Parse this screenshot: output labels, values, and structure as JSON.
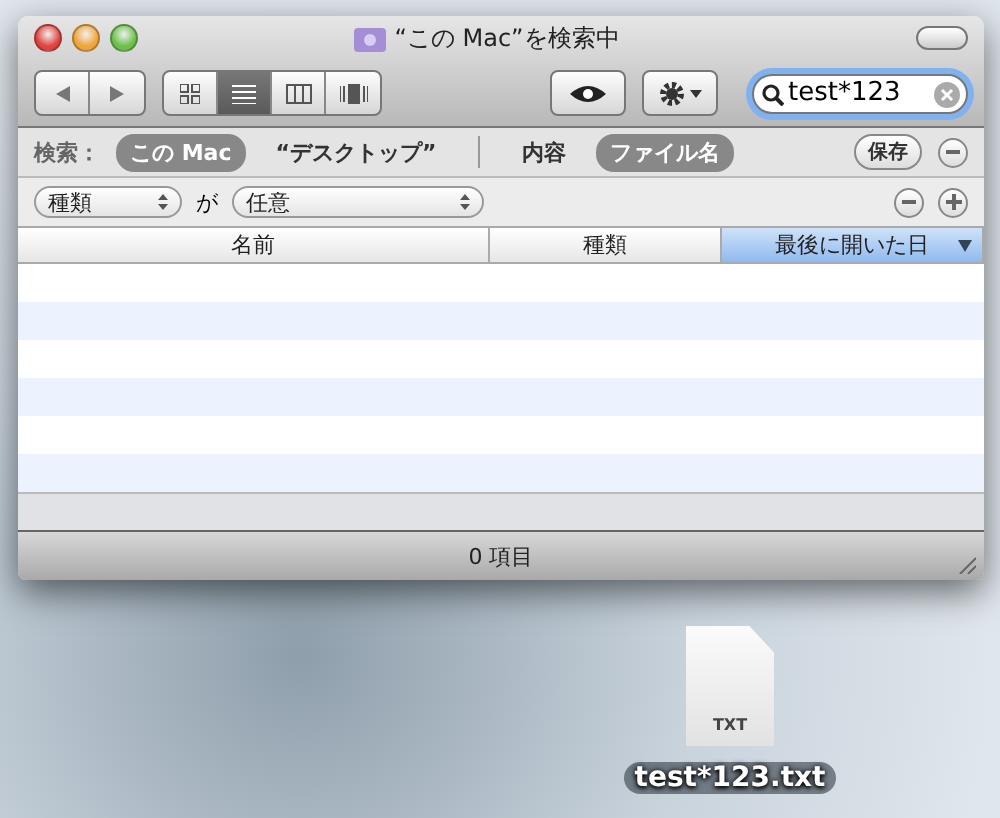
{
  "window": {
    "title": "“この Mac”を検索中"
  },
  "toolbar": {
    "view_modes": [
      {
        "kind": "icon",
        "selected": false
      },
      {
        "kind": "list",
        "selected": true
      },
      {
        "kind": "column",
        "selected": false
      },
      {
        "kind": "coverflow",
        "selected": false
      }
    ],
    "search": {
      "value": "test*123"
    }
  },
  "scope_bar": {
    "label": "検索：",
    "locations": [
      {
        "label": "この Mac",
        "selected": true
      },
      {
        "label": "“デスクトップ”",
        "selected": false
      }
    ],
    "attributes": [
      {
        "label": "内容",
        "selected": false
      },
      {
        "label": "ファイル名",
        "selected": true
      }
    ],
    "save": "保存"
  },
  "criteria": {
    "attribute": "種類",
    "operator": "が",
    "value": "任意"
  },
  "table": {
    "columns": [
      {
        "label": "名前",
        "selected": false
      },
      {
        "label": "種類",
        "selected": false
      },
      {
        "label": "最後に開いた日",
        "selected": true
      }
    ]
  },
  "status_bar": "0 項目",
  "desktop_file": {
    "badge": "TXT",
    "name": "test*123.txt"
  }
}
